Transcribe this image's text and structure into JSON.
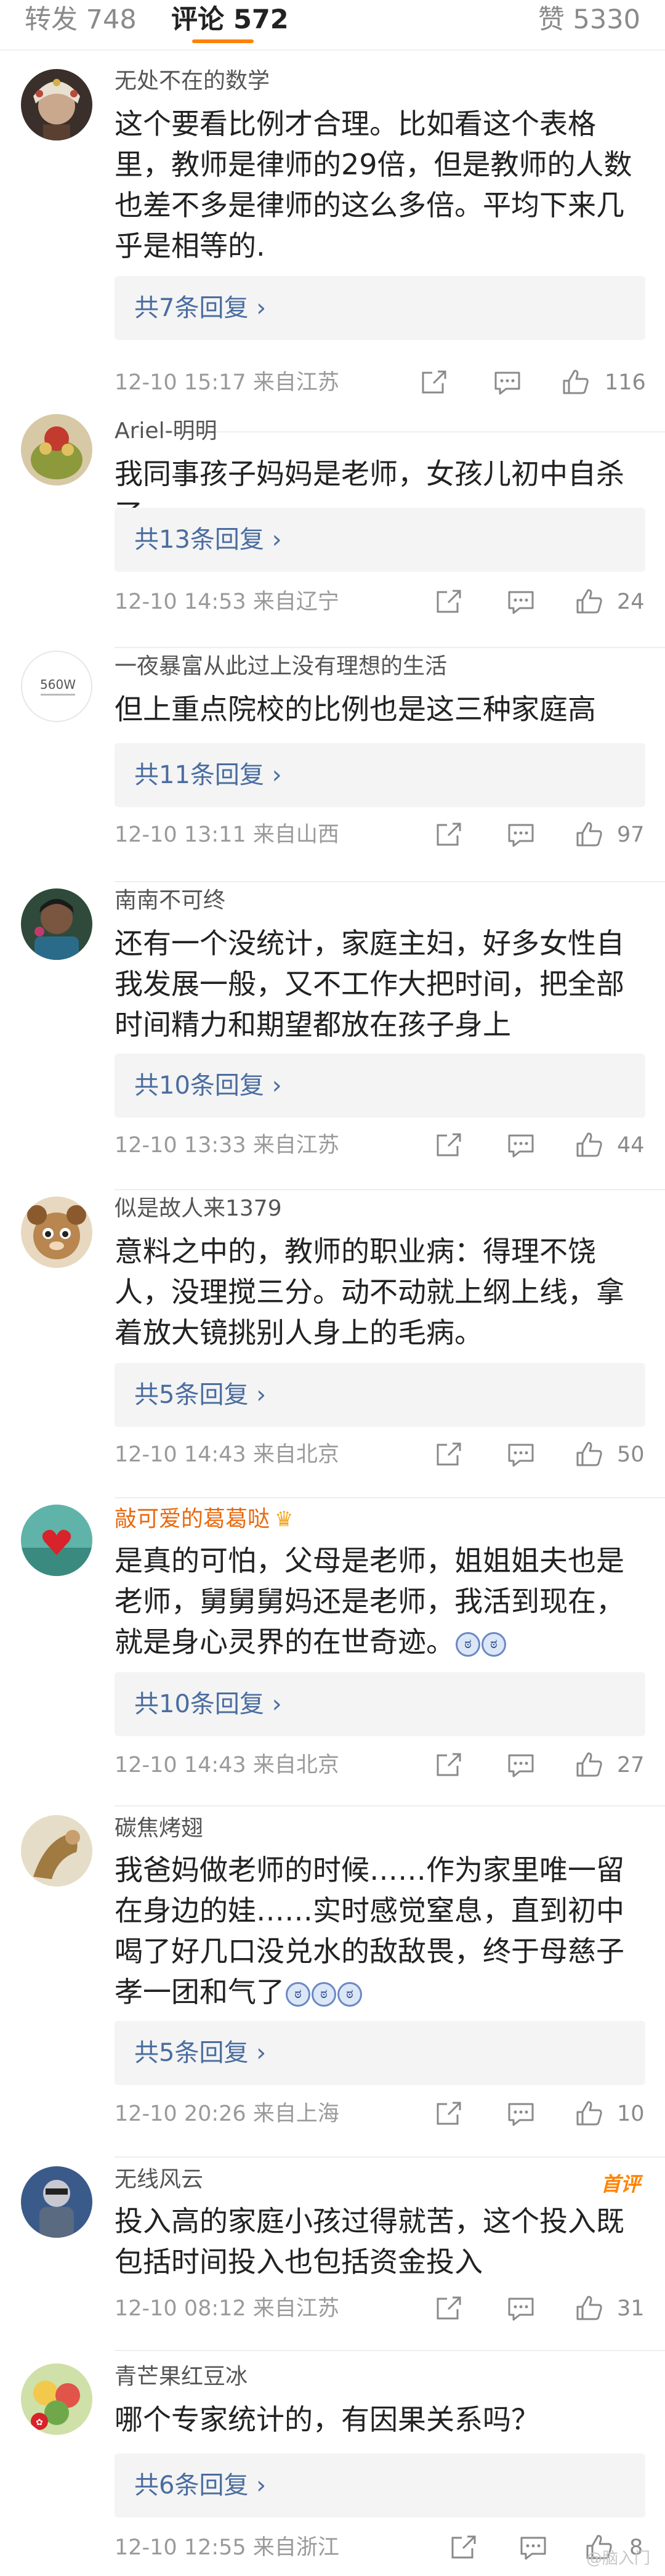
{
  "tabs": {
    "repost": "转发 748",
    "comment": "评论 572",
    "like": "赞 5330"
  },
  "colors": {
    "accent": "#ff8200",
    "link": "#4a6da0",
    "vip_name": "#e86a10"
  },
  "icons": [
    "share-icon",
    "comment-icon",
    "thumbs-up-icon",
    "chevron-right-icon",
    "crown-icon"
  ],
  "comments": [
    {
      "user": "无处不在的数学",
      "text": "这个要看比例才合理。比如看这个表格里，教师是律师的29倍，但是教师的人数也差不多是律师的这么多倍。平均下来几乎是相等的.",
      "replies": "共7条回复 ›",
      "meta": "12-10 15:17  来自江苏",
      "likes": "116"
    },
    {
      "user": "Ariel-明明",
      "text": "我同事孩子妈妈是老师，女孩儿初中自杀了",
      "replies": "共13条回复 ›",
      "meta": "12-10 14:53  来自辽宁",
      "likes": "24"
    },
    {
      "user": "一夜暴富从此过上没有理想的生活",
      "avatar_text": "560W",
      "text": "但上重点院校的比例也是这三种家庭高",
      "replies": "共11条回复 ›",
      "meta": "12-10 13:11  来自山西",
      "likes": "97"
    },
    {
      "user": "南南不可终",
      "text": "还有一个没统计，家庭主妇，好多女性自我发展一般，又不工作大把时间，把全部时间精力和期望都放在孩子身上",
      "replies": "共10条回复 ›",
      "meta": "12-10 13:33  来自江苏",
      "likes": "44"
    },
    {
      "user": "似是故人来1379",
      "text": "意料之中的，教师的职业病：得理不饶人，没理搅三分。动不动就上纲上线，拿着放大镜挑别人身上的毛病。",
      "replies": "共5条回复 ›",
      "meta": "12-10 14:43  来自北京",
      "likes": "50"
    },
    {
      "user": "敲可爱的葛葛哒",
      "text": "是真的可怕，父母是老师，姐姐姐夫也是老师，舅舅舅妈还是老师，我活到现在，就是身心灵界的在世奇迹。",
      "replies": "共10条回复 ›",
      "meta": "12-10 14:43  来自北京",
      "likes": "27"
    },
    {
      "user": "碳焦烤翅",
      "text": "我爸妈做老师的时候……作为家里唯一留在身边的娃……实时感觉窒息，直到初中喝了好几口没兑水的敌敌畏，终于母慈子孝一团和气了",
      "replies": "共5条回复 ›",
      "meta": "12-10 20:26  来自上海",
      "likes": "10"
    },
    {
      "user": "无线风云",
      "badge": "首评",
      "text": "投入高的家庭小孩过得就苦，这个投入既包括时间投入也包括资金投入",
      "meta": "12-10 08:12  来自江苏",
      "likes": "31"
    },
    {
      "user": "青芒果红豆冰",
      "text": "哪个专家统计的，有因果关系吗？",
      "replies": "共6条回复 ›",
      "meta": "12-10 12:55  来自浙江",
      "likes": "8"
    }
  ],
  "watermark": "@脑入门"
}
